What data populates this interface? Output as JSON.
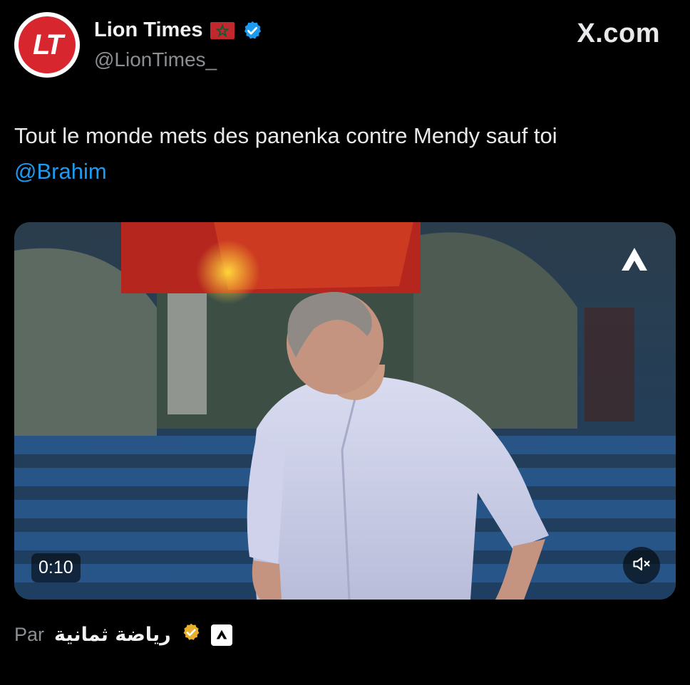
{
  "author": {
    "avatar_text": "LT",
    "display_name": "Lion Times",
    "handle": "@LionTimes_",
    "flag_icon": "morocco-flag-icon",
    "verified_icon": "verified-badge-icon",
    "verified_color": "#1d9bf0"
  },
  "site": {
    "logo_text": "X.com"
  },
  "tweet": {
    "text": "Tout le monde mets des panenka contre Mendy sauf toi",
    "mention": "@Brahim"
  },
  "video": {
    "duration": "0:10",
    "mute_icon": "speaker-muted-icon",
    "watermark_icon": "source-watermark-icon"
  },
  "attribution": {
    "prefix": "Par",
    "name": "رياضة ثمانية",
    "badge_icon": "gold-verified-badge-icon",
    "badge_color": "#e8b02a"
  },
  "colors": {
    "background": "#000000",
    "link": "#1d9bf0",
    "secondary_text": "#8a8f94",
    "brand_red": "#d7262e"
  }
}
